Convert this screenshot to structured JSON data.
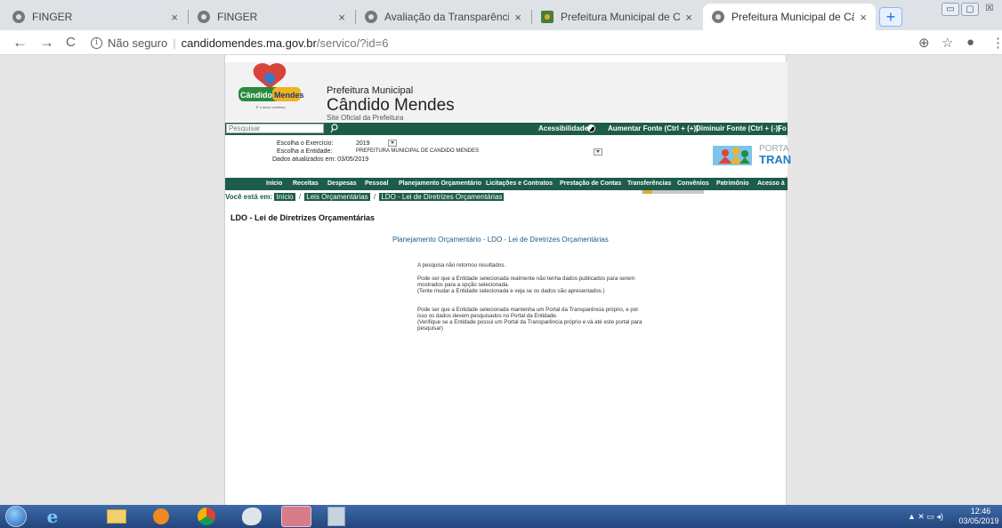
{
  "tabs": [
    {
      "title": "FINGER",
      "close": "×",
      "icon": "globe-icon"
    },
    {
      "title": "FINGER",
      "close": "×",
      "icon": "globe-icon"
    },
    {
      "title": "Avaliação da Transparência dos",
      "close": "×",
      "icon": "globe-icon"
    },
    {
      "title": "Prefeitura Municipal de Cândido",
      "close": "×",
      "icon": "crest-icon"
    },
    {
      "title": "Prefeitura Municipal de Cândido",
      "close": "×",
      "icon": "globe-icon"
    }
  ],
  "newtab_label": "+",
  "window": {
    "minimize": "▭",
    "maximize": "▢",
    "close": "☒"
  },
  "toolbar": {
    "back": "←",
    "forward": "→",
    "reload": "C",
    "security": "Não seguro",
    "host": "candidomendes.ma.gov.br",
    "path": "/servico/?id=6",
    "zoom": "⊕",
    "star": "☆",
    "profile": "●",
    "menu": "⋮"
  },
  "site": {
    "logo_word1": "Cândido",
    "logo_word2": "Mendes",
    "logo_slogan": "É o amor continua",
    "header_line1": "Prefeitura Municipal",
    "header_line2": "Cândido Mendes",
    "header_line3": "Site Oficial da Prefeitura",
    "search_placeholder": "Pesquisar",
    "accessibility": "Acessibilidade:",
    "font_bigger": "Aumentar Fonte (Ctrl + (+))",
    "font_smaller": "Diminuir Fonte (Ctrl + (-))",
    "font_more": "Fo",
    "exercise_label": "Escolha o Exercício:",
    "exercise_value": "2019",
    "entity_label": "Escolha a Entidade:",
    "entity_value": "PREFEITURA MUNICIPAL DE CANDIDO MENDES",
    "updated": "Dados atualizados em: 03/05/2019",
    "portal_line1": "PORTA",
    "portal_line2": "TRAN"
  },
  "menu": [
    "Início",
    "Receitas",
    "Despesas",
    "Pessoal",
    "Planejamento Orçamentário",
    "Licitações e Contratos",
    "Prestação de Contas",
    "Transferências",
    "Convênios",
    "Patrimônio",
    "Acesso à"
  ],
  "breadcrumb": {
    "prefix": "Você está em:",
    "items": [
      "Início",
      "Leis Orçamentárias",
      "LDO - Lei de Diretrizes Orçamentárias"
    ],
    "sep": "/"
  },
  "content": {
    "heading": "LDO - Lei de Diretrizes Orçamentárias",
    "section_title": "Planejamento Orçamentário - LDO - Lei de Diretrizes Orçamentárias",
    "p1": "A pesquisa não retornou resultados.",
    "p2": "Pode ser que a Entidade selecionada realmente não tenha dados publicados para serem mostrados para a opção selecionada.",
    "p2b": "(Tente mudar a Entidade selecionada e veja se os dados são apresentados.)",
    "p3": "Pode ser que a Entidade selecionada mantenha um Portal da Transparência próprio, e por isso os dados devem pesquisados no Portal da Entidade.",
    "p3b": "(Verifique se a Entidade possui um Portal da Transparência próprio e vá até este portal para pesquisar)"
  },
  "taskbar": {
    "time": "12:46",
    "date": "03/05/2019",
    "apps": [
      "start-orb",
      "ie-icon",
      "explorer-icon",
      "media-player-icon",
      "chrome-icon",
      "paint-icon",
      "snipping-tool-icon",
      "calculator-icon"
    ]
  },
  "colors": {
    "site_green": "#1d5c4a",
    "tab_strip": "#dee1e6",
    "taskbar": "#2a4f8a"
  }
}
